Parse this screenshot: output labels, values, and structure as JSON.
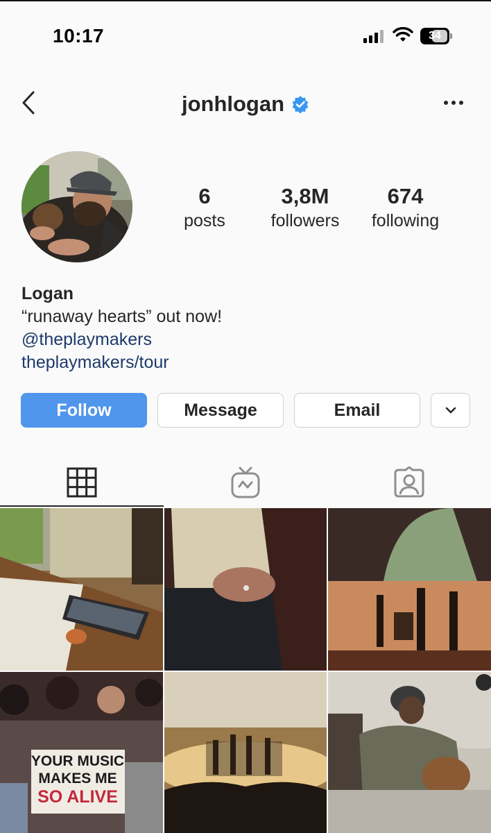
{
  "status_bar": {
    "time": "10:17",
    "battery": "34"
  },
  "header": {
    "username": "jonhlogan",
    "verified": true
  },
  "profile": {
    "stats": {
      "posts_count": "6",
      "posts_label": "posts",
      "followers_count": "3,8M",
      "followers_label": "followers",
      "following_count": "674",
      "following_label": "following"
    },
    "bio": {
      "name": "Logan",
      "line1": "“runaway hearts” out now!",
      "mention": "@theplaymakers",
      "link": "theplaymakers/tour"
    }
  },
  "actions": {
    "follow": "Follow",
    "message": "Message",
    "email": "Email"
  },
  "tabs": [
    {
      "icon": "grid-icon",
      "active": true
    },
    {
      "icon": "igtv-icon",
      "active": false
    },
    {
      "icon": "tagged-icon",
      "active": false
    }
  ],
  "posts": {
    "sign_text_1": "YOUR MUSIC",
    "sign_text_2": "MAKES ME",
    "sign_text_3": "SO ALIVE"
  },
  "colors": {
    "follow_button": "#4f96ec",
    "verified_badge": "#3897f0",
    "link": "#1d3a6b"
  }
}
